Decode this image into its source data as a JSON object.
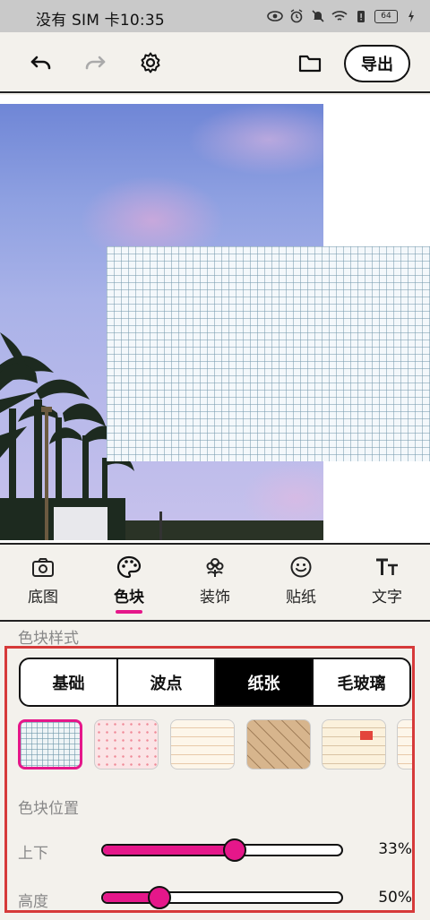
{
  "status": {
    "carrier_time": "没有 SIM 卡10:35",
    "battery": "64",
    "icons": [
      "eye-icon",
      "alarm-icon",
      "bell-off-icon",
      "wifi-icon",
      "battery-saver-icon",
      "battery-icon",
      "charging-icon"
    ]
  },
  "toolbar": {
    "export_label": "导出",
    "icons": [
      "undo-icon",
      "redo-icon",
      "settings-icon",
      "folder-icon"
    ]
  },
  "tabs": [
    {
      "label": "底图",
      "icon": "camera-icon"
    },
    {
      "label": "色块",
      "icon": "palette-icon",
      "active": true
    },
    {
      "label": "装饰",
      "icon": "flower-icon"
    },
    {
      "label": "贴纸",
      "icon": "smiley-icon"
    },
    {
      "label": "文字",
      "icon": "text-icon"
    }
  ],
  "style_section": {
    "title": "色块样式",
    "segments": [
      "基础",
      "波点",
      "纸张",
      "毛玻璃"
    ],
    "selected_segment": "纸张",
    "swatches": [
      "grid",
      "dots",
      "lined",
      "kraft-stripes",
      "note-tag",
      "lined-partial"
    ]
  },
  "position_section": {
    "title": "色块位置",
    "sliders": [
      {
        "label": "上下",
        "value_text": "33%",
        "value": 0.55
      },
      {
        "label": "高度",
        "value_text": "50%",
        "value": 0.24
      }
    ]
  },
  "colors": {
    "accent": "#e5178a",
    "highlight_frame": "#d63a3a",
    "background": "#f3f1ec"
  }
}
